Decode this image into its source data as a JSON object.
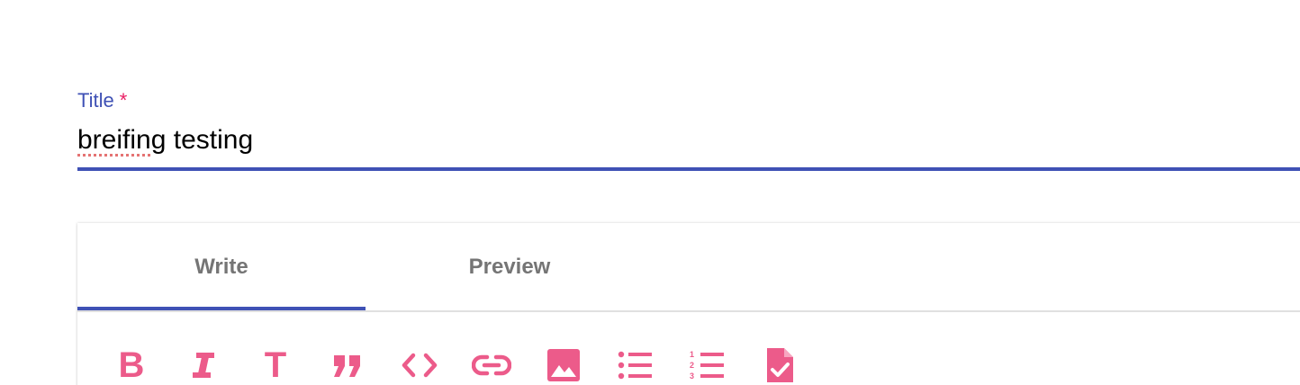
{
  "title_field": {
    "label": "Title",
    "required_marker": "*",
    "value_misspelled": "breifing",
    "value_rest": " testing"
  },
  "editor": {
    "tabs": [
      {
        "label": "Write",
        "active": true
      },
      {
        "label": "Preview",
        "active": false
      }
    ],
    "toolbar": [
      {
        "icon": "bold-icon",
        "glyph": "B"
      },
      {
        "icon": "italic-icon"
      },
      {
        "icon": "header-icon",
        "glyph": "T"
      },
      {
        "icon": "quote-icon",
        "glyph": "❞"
      },
      {
        "icon": "code-icon"
      },
      {
        "icon": "link-icon"
      },
      {
        "icon": "image-icon"
      },
      {
        "icon": "unordered-list-icon"
      },
      {
        "icon": "ordered-list-icon"
      },
      {
        "icon": "checked-list-icon"
      }
    ]
  },
  "colors": {
    "accent": "#3f51b5",
    "toolbar_icon": "#ec5b8a",
    "required": "#e91e63",
    "tab_text": "#757575",
    "spellcheck": "#e57373"
  }
}
